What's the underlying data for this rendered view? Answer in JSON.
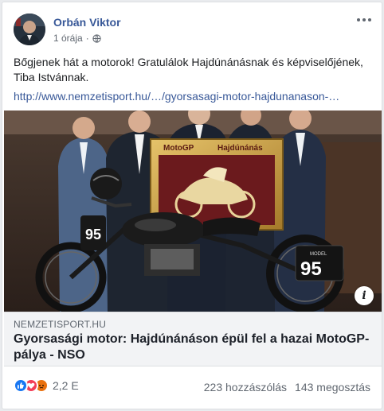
{
  "post": {
    "author": "Orbán Viktor",
    "time": "1 órája",
    "privacy_icon": "globe-icon",
    "text": "Bőgjenek hát a motorok! Gratulálok Hajdúnánásnak és képviselőjének, Tiba Istvánnak.",
    "link_text": "http://www.nemzetisport.hu/…/gyorsasagi-motor-hajdunanason-…"
  },
  "photo": {
    "frame_title_left": "MotoGP",
    "frame_title_right": "Hajdúnánás",
    "plate_number": "95",
    "plate_label": "MODEL",
    "tank_badge": "95"
  },
  "link_preview": {
    "domain": "NEMZETISPORT.HU",
    "headline": "Gyorsasági motor: Hajdúnánáson épül fel a hazai MotoGP-pálya - NSO"
  },
  "footer": {
    "reaction_icons": [
      "like-icon",
      "love-icon",
      "angry-icon"
    ],
    "reaction_count": "2,2 E",
    "comments": "223 hozzászólás",
    "shares": "143 megosztás"
  },
  "colors": {
    "link": "#385898",
    "like": "#1877f2",
    "love": "#f33e58",
    "angry": "#e9710f"
  }
}
